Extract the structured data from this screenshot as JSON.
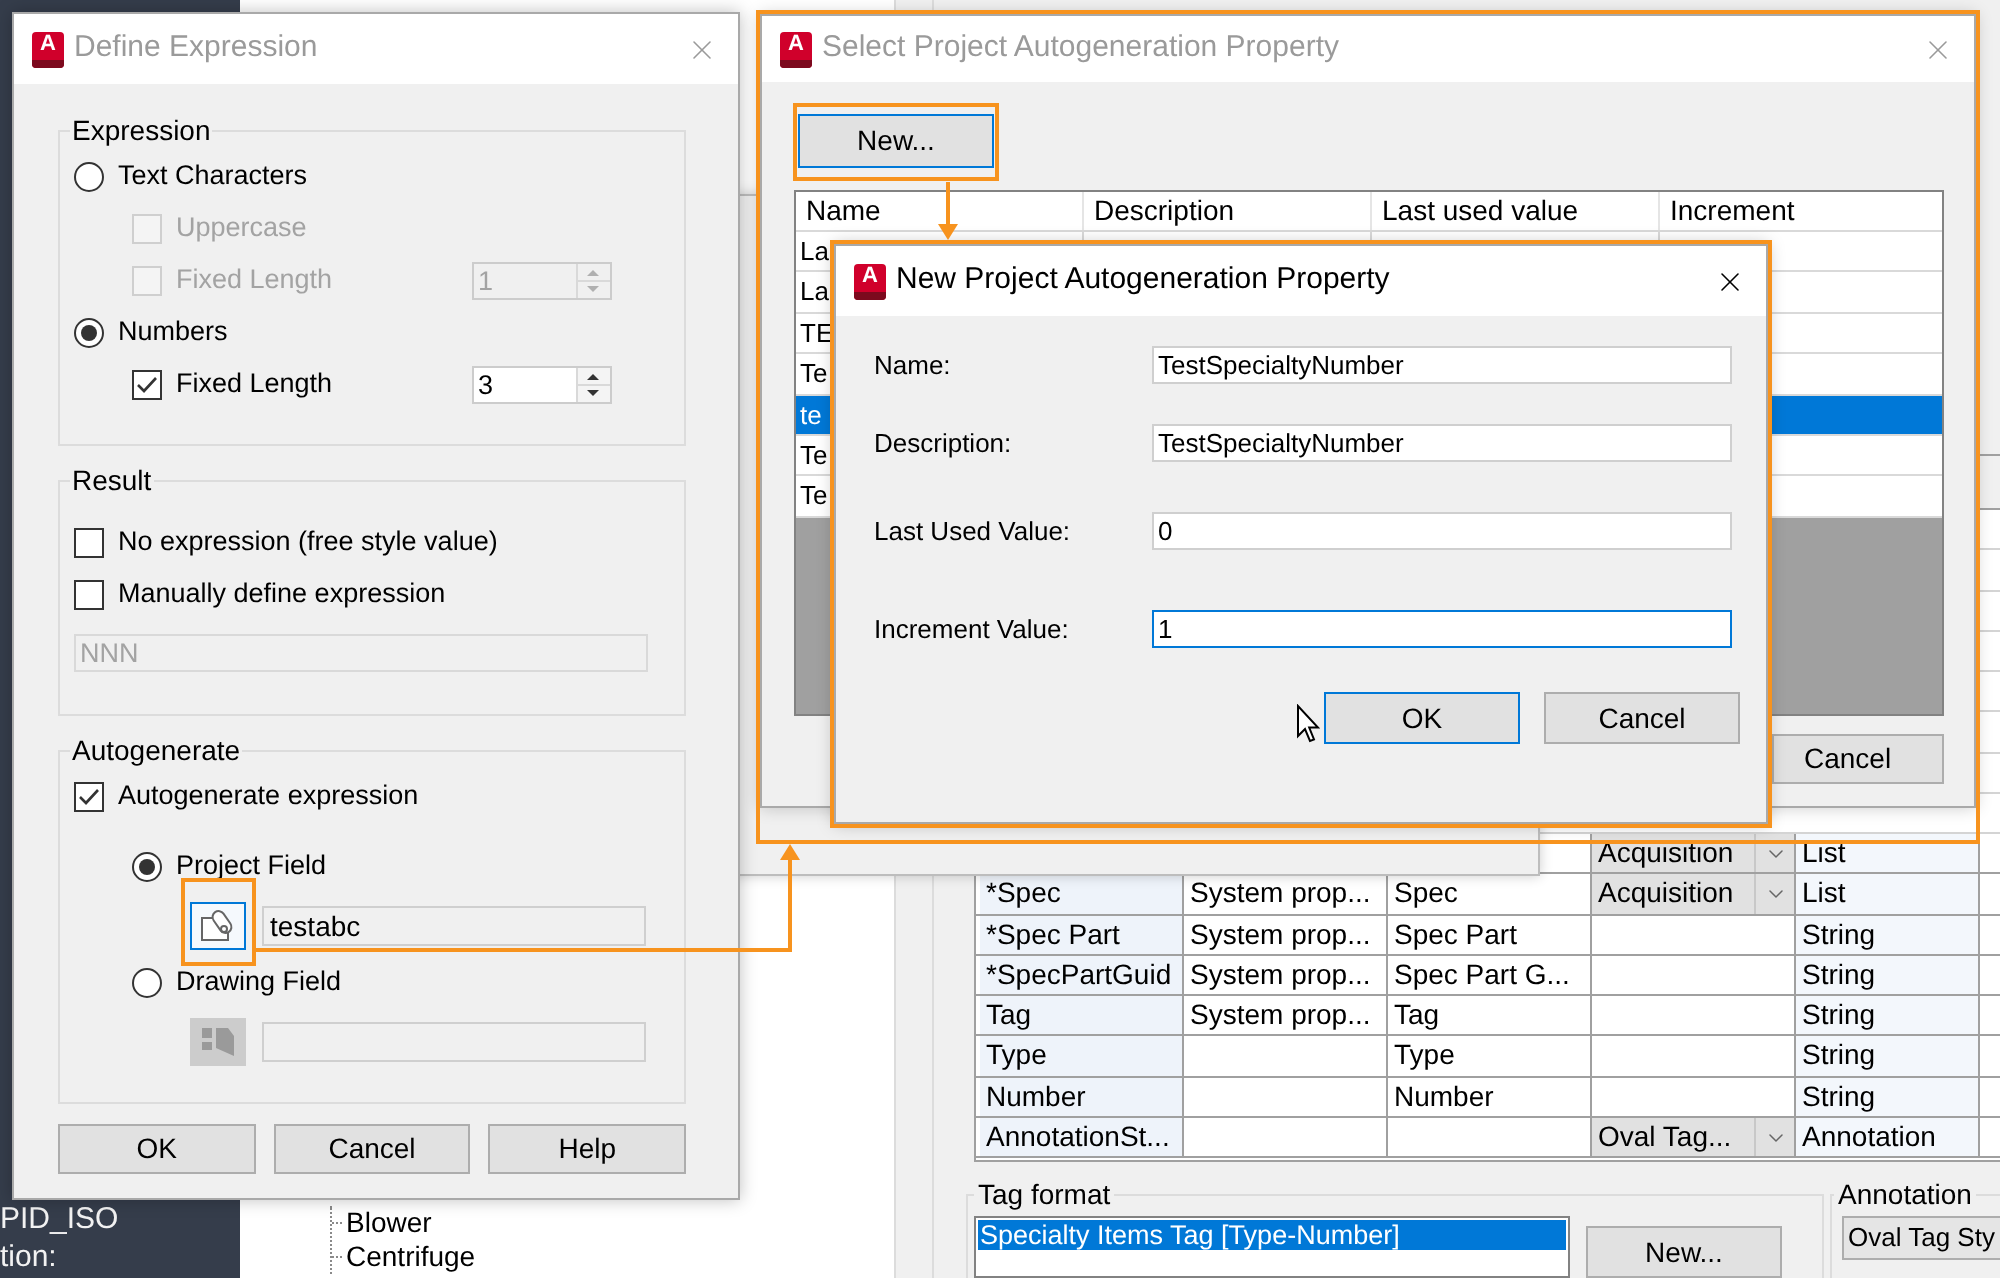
{
  "background_app": {
    "side_panel": {
      "lines": [
        "PID_ISO",
        "tion:"
      ]
    },
    "tree": {
      "items": [
        {
          "label": "Blower"
        },
        {
          "label": "Centrifuge"
        }
      ]
    },
    "property_grid": {
      "rows": [
        {
          "column_4": {
            "value": "Acquisition",
            "kind": "dropdown"
          },
          "column_5": "List"
        },
        {
          "column_1": "*Spec",
          "column_2": "System prop...",
          "column_3": "Spec",
          "column_4": {
            "value": "Acquisition",
            "kind": "dropdown"
          },
          "column_5": "List"
        },
        {
          "column_1": "*Spec Part",
          "column_2": "System prop...",
          "column_3": "Spec Part",
          "column_5": "String"
        },
        {
          "column_1": "*SpecPartGuid",
          "column_2": "System prop...",
          "column_3": "Spec Part G...",
          "column_5": "String"
        },
        {
          "column_1": "Tag",
          "column_2": "System prop...",
          "column_3": "Tag",
          "column_5": "String"
        },
        {
          "column_1": "Type",
          "column_3": "Type",
          "column_5": "String"
        },
        {
          "column_1": "Number",
          "column_3": "Number",
          "column_5": "String"
        },
        {
          "column_1": "AnnotationSt...",
          "column_4": {
            "value": "Oval Tag...",
            "kind": "dropdown"
          },
          "column_5": "Annotation"
        }
      ]
    },
    "tag_format": {
      "label": "Tag format",
      "items": [
        {
          "label": "Specialty Items Tag [Type-Number]",
          "selected": true
        }
      ],
      "new_button": "New..."
    },
    "annotation": {
      "label": "Annotation",
      "value": "Oval Tag Sty"
    }
  },
  "define_expression_dialog": {
    "logo": "A",
    "title": "Define Expression",
    "active": false,
    "groups": [
      {
        "title": "Expression",
        "items": [
          {
            "kind": "radio",
            "label": "Text Characters",
            "selected": false,
            "children": [
              {
                "kind": "checkbox",
                "label": "Uppercase",
                "checked": false,
                "disabled": true
              },
              {
                "kind": "checkbox",
                "label": "Fixed Length",
                "checked": false,
                "disabled": true,
                "spinner": "1"
              }
            ]
          },
          {
            "kind": "radio",
            "label": "Numbers",
            "selected": true,
            "children": [
              {
                "kind": "checkbox",
                "label": "Fixed Length",
                "checked": true,
                "disabled": false,
                "spinner": "3"
              }
            ]
          }
        ]
      },
      {
        "title": "Result",
        "items": [
          {
            "kind": "checkbox",
            "label": "No expression (free style value)",
            "checked": false,
            "disabled": false
          },
          {
            "kind": "checkbox",
            "label": "Manually define expression",
            "checked": false,
            "disabled": false
          },
          {
            "kind": "text_field",
            "value": "NNN",
            "disabled": true
          }
        ]
      },
      {
        "title": "Autogenerate",
        "items": [
          {
            "kind": "checkbox",
            "label": "Autogenerate expression",
            "checked": true,
            "disabled": false,
            "children": [
              {
                "kind": "radio",
                "label": "Project Field",
                "selected": true,
                "children": [
                  {
                    "kind": "project_picker",
                    "value": "testabc",
                    "disabled": false,
                    "focused": true
                  }
                ]
              },
              {
                "kind": "radio",
                "label": "Drawing Field",
                "selected": false,
                "children": [
                  {
                    "kind": "drawing_picker",
                    "disabled": true,
                    "focused": false
                  }
                ]
              }
            ]
          }
        ]
      }
    ],
    "buttons": [
      "OK",
      "Cancel",
      "Help"
    ]
  },
  "select_property_dialog": {
    "logo": "A",
    "title": "Select Project Autogeneration Property",
    "active": false,
    "new_button": {
      "label": "New...",
      "default": true
    },
    "table": {
      "columns": [
        "Name",
        "Description",
        "Last used value",
        "Increment"
      ],
      "rows": [
        {
          "name": "La",
          "selected": false
        },
        {
          "name": "La",
          "selected": false
        },
        {
          "name": "TE",
          "selected": false
        },
        {
          "name": "Te",
          "selected": false
        },
        {
          "name": "te",
          "selected": true
        },
        {
          "name": "Te",
          "selected": false
        },
        {
          "name": "Te",
          "selected": false
        }
      ]
    },
    "cancel_button": {
      "label": "Cancel",
      "default": false
    }
  },
  "new_property_dialog": {
    "logo": "A",
    "title": "New Project Autogeneration Property",
    "active": true,
    "fields": [
      {
        "label": "Name:",
        "value": "TestSpecialtyNumber",
        "focused": false
      },
      {
        "label": "Description:",
        "value": "TestSpecialtyNumber",
        "focused": false
      },
      {
        "label": "Last Used Value:",
        "value": "0",
        "focused": false
      },
      {
        "label": "Increment Value:",
        "value": "1",
        "focused": true
      }
    ],
    "buttons": [
      {
        "label": "OK",
        "default": true
      },
      {
        "label": "Cancel",
        "default": false
      }
    ]
  }
}
